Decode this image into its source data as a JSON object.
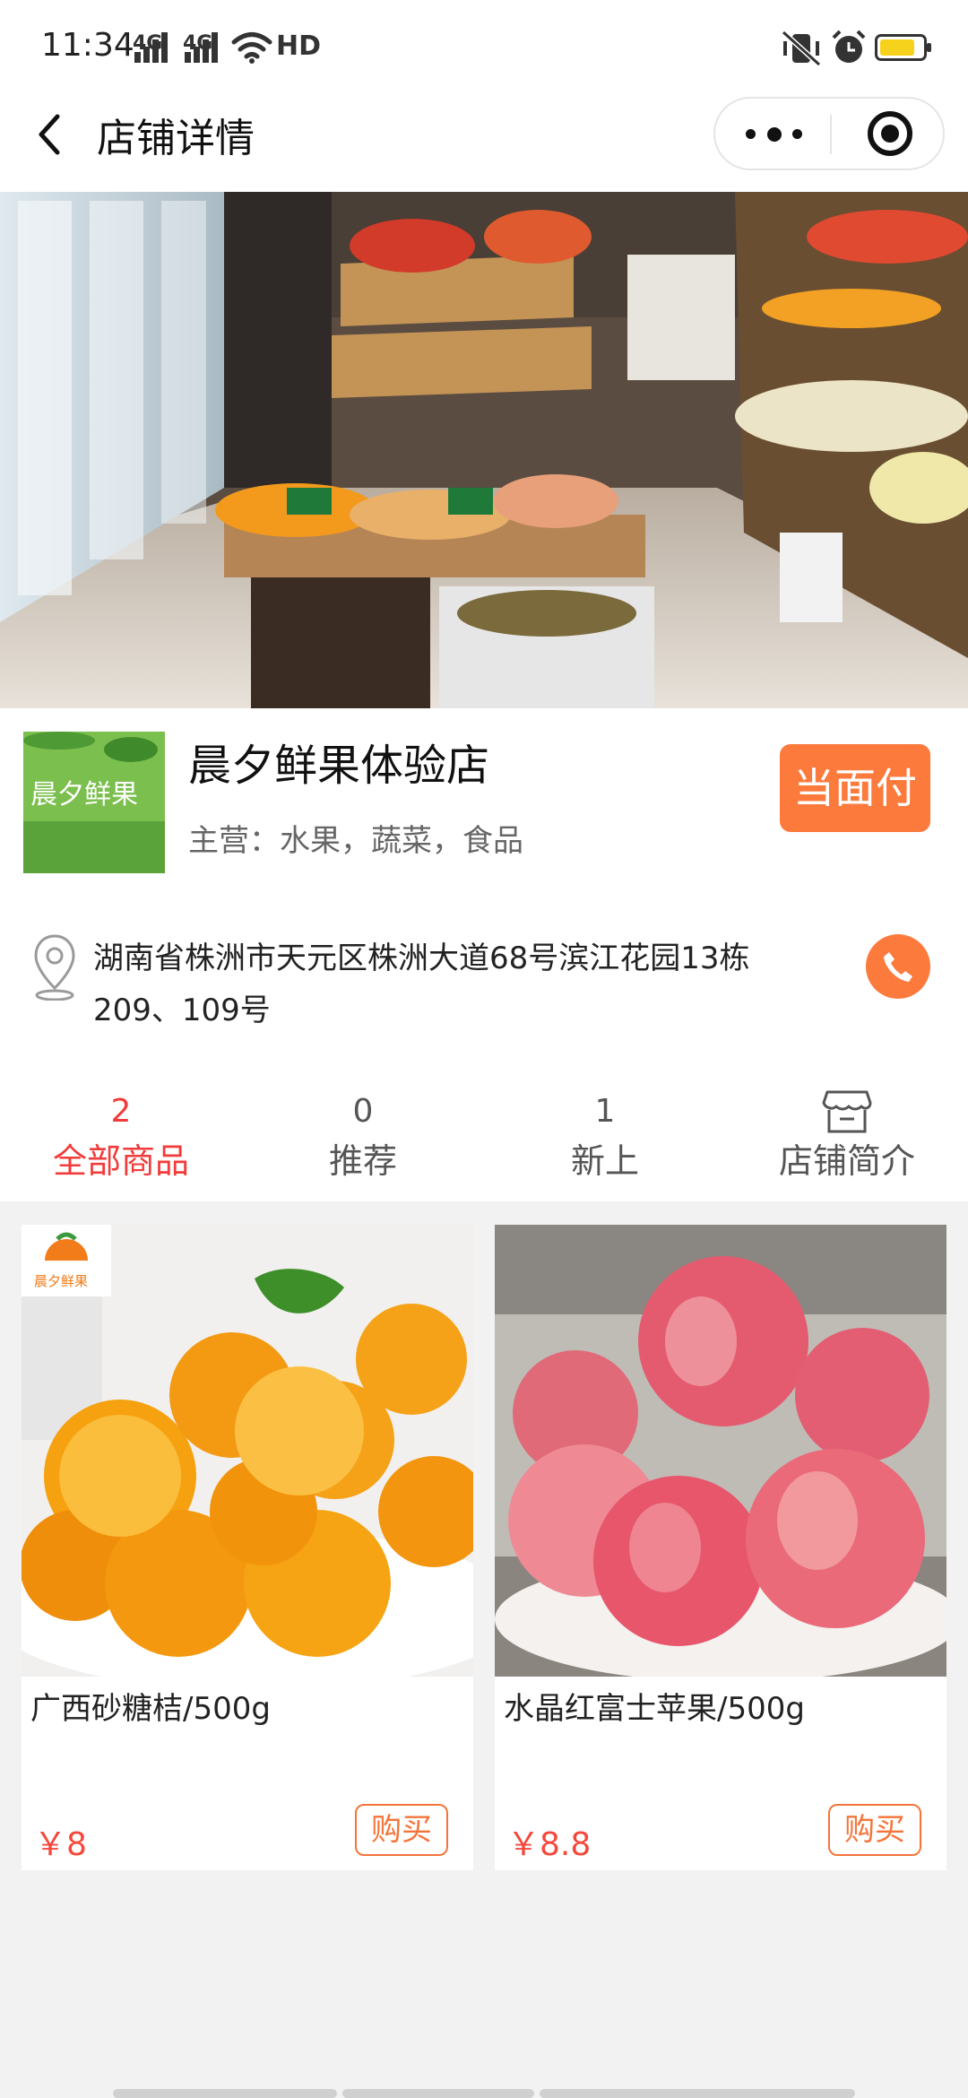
{
  "status_bar": {
    "time": "11:34",
    "signal1_label": "4G",
    "signal2_label": "4G",
    "network": "HD"
  },
  "nav": {
    "title": "店铺详情"
  },
  "store": {
    "name": "晨夕鲜果体验店",
    "main_business": "主营：水果，蔬菜，食品",
    "pay_label": "当面付",
    "address": "湖南省株洲市天元区株洲大道68号滨江花园13栋209、109号",
    "logo_text": "晨夕鲜果"
  },
  "tabs": [
    {
      "count": "2",
      "label": "全部商品"
    },
    {
      "count": "0",
      "label": "推荐"
    },
    {
      "count": "1",
      "label": "新上"
    },
    {
      "label": "店铺简介"
    }
  ],
  "products": [
    {
      "name": "广西砂糖桔/500g",
      "price": "￥8",
      "buy": "购买",
      "badge": "晨夕鲜果"
    },
    {
      "name": "水晶红富士苹果/500g",
      "price": "￥8.8",
      "buy": "购买"
    }
  ],
  "colors": {
    "accent": "#fb7a3c",
    "active_tab": "#f23b3b",
    "price": "#f5483c"
  }
}
